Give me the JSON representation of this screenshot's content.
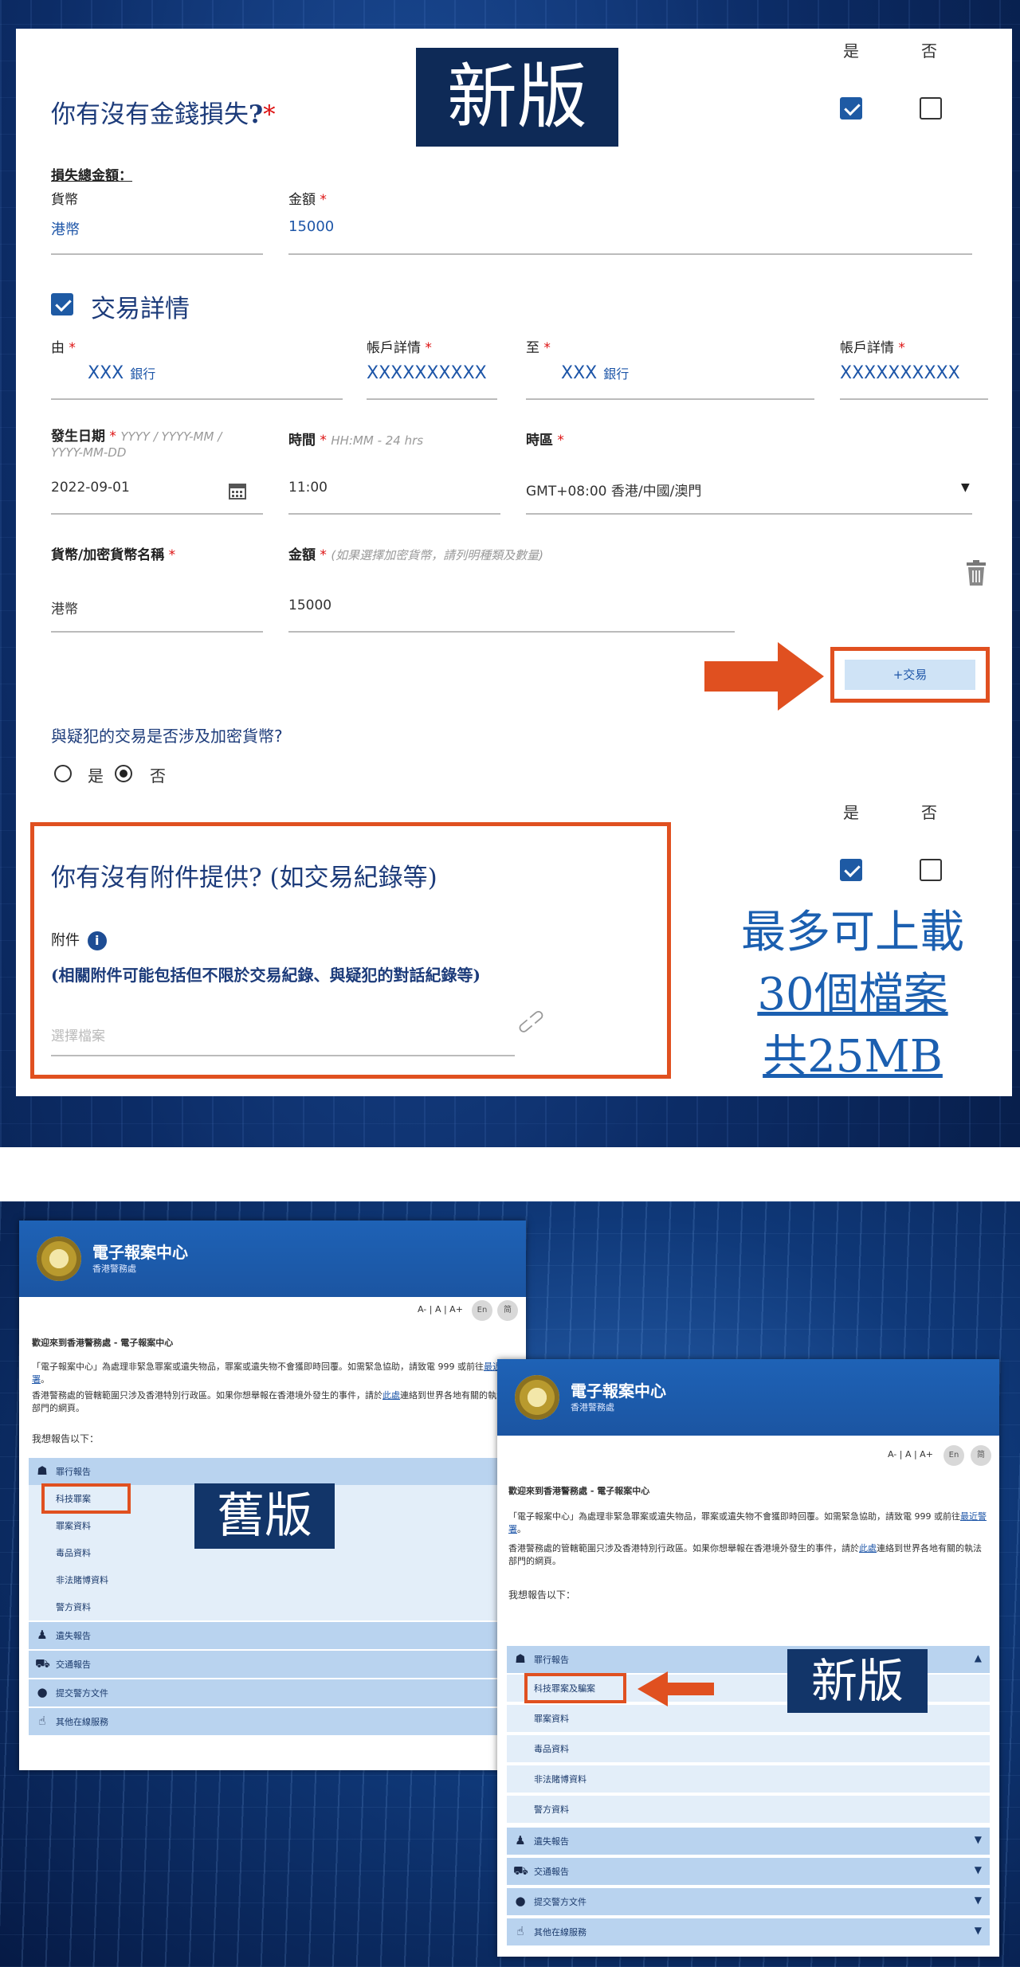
{
  "form": {
    "new_badge": "新版",
    "loss_question": "你有沒有金錢損失",
    "loss_q_mark": "?",
    "loss_required": "*",
    "yes": "是",
    "no": "否",
    "total_loss_label": "損失總金額：",
    "currency_label": "貨幣",
    "amount_label": "金額",
    "required_star": "*",
    "currency_value": "港幣",
    "amount_value": "15000",
    "txn_section_title": "交易詳情",
    "from_label": "由",
    "account_label": "帳戶詳情",
    "to_label": "至",
    "from_bank": "XXX",
    "bank_suffix": "銀行",
    "from_account": "XXXXXXXXXX",
    "to_bank": "XXX",
    "to_account": "XXXXXXXXXX",
    "date_label": "發生日期",
    "date_hint": "YYYY / YYYY-MM / YYYY-MM-DD",
    "time_label": "時間",
    "time_hint": "HH:MM - 24 hrs",
    "tz_label": "時區",
    "date_value": "2022-09-01",
    "time_value": "11:00",
    "tz_value": "GMT+08:00 香港/中國/澳門",
    "crypto_currency_label": "貨幣/加密貨幣名稱",
    "crypto_amount_hint": "(如果選擇加密貨幣，請列明種類及數量)",
    "currency_value2": "港幣",
    "amount_value2": "15000",
    "add_txn_button": "+交易",
    "crypto_question": "與疑犯的交易是否涉及加密貨幣?",
    "radio_yes": "是",
    "radio_no": "否",
    "attach_question": "你有沒有附件提供? (如交易紀錄等)",
    "attach_label": "附件",
    "attach_note": "(相關附件可能包括但不限於交易紀錄、與疑犯的對話紀錄等)",
    "attach_placeholder": "選擇檔案",
    "upload_note_1": "最多可上載",
    "upload_note_2": "30個檔案",
    "upload_note_3": "共25MB"
  },
  "old_site": {
    "badge": "舊版",
    "title": "電子報案中心",
    "subtitle": "香港警務處",
    "font_controls": "A- | A | A+",
    "welcome": "歡迎來到香港警務處 - 電子報案中心",
    "intro_1": "「電子報案中心」為處理非緊急罪案或遺失物品，罪案或遺失物不會獲即時回覆。如需緊急協助，請致電 999 或前往",
    "intro_link": "最近警署",
    "intro_2": "。",
    "intro_3": "香港警務處的管轄範圍只涉及香港特別行政區。如果你想舉報在香港境外發生的事件，請於",
    "intro_3b": "此處",
    "intro_3c": "連絡到世界各地有關的執法部門的網頁。",
    "report_heading": "我想報告以下：",
    "menu_crime": "罪行報告",
    "sub_items": [
      "科技罪案",
      "罪案資料",
      "毒品資料",
      "非法賭博資料",
      "警方資料"
    ],
    "menu_items": [
      "遺失報告",
      "交通報告",
      "提交警方文件",
      "其他在線服務"
    ]
  },
  "new_site": {
    "badge": "新版",
    "title": "電子報案中心",
    "subtitle": "香港警務處",
    "font_controls": "A- | A | A+",
    "welcome": "歡迎來到香港警務處 - 電子報案中心",
    "intro_1": "「電子報案中心」為處理非緊急罪案或遺失物品，罪案或遺失物不會獲即時回覆。如需緊急協助，請致電 999 或前往",
    "intro_link": "最近警署",
    "intro_2": "。",
    "intro_3": "香港警務處的管轄範圍只涉及香港特別行政區。如果你想舉報在香港境外發生的事件，請於",
    "intro_3b": "此處",
    "intro_3c": "連絡到世界各地有關的執法部門的網頁。",
    "report_heading": "我想報告以下：",
    "menu_crime": "罪行報告",
    "sub_items": [
      "科技罪案及騙案",
      "罪案資料",
      "毒品資料",
      "非法賭博資料",
      "警方資料"
    ],
    "menu_items": [
      "遺失報告",
      "交通報告",
      "提交警方文件",
      "其他在線服務"
    ]
  },
  "colors": {
    "accent_orange": "#e05020",
    "navy": "#0e2a57",
    "link_blue": "#1e56a8"
  }
}
